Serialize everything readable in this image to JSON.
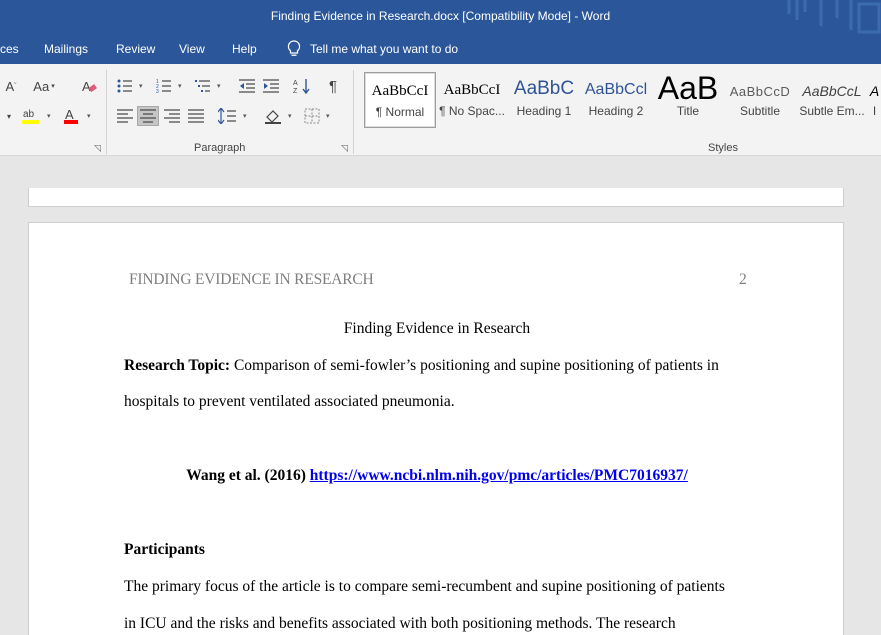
{
  "window": {
    "title": "Finding Evidence in Research.docx [Compatibility Mode]  -  Word"
  },
  "menu": {
    "items": [
      "ces",
      "Mailings",
      "Review",
      "View",
      "Help"
    ],
    "tell_me": "Tell me what you want to do"
  },
  "ribbon": {
    "font_size_label": "Aa",
    "paragraph_label": "Paragraph",
    "styles_label": "Styles",
    "styles": [
      {
        "sample": "AaBbCcI",
        "name": "¶ Normal",
        "selected": true
      },
      {
        "sample": "AaBbCcI",
        "name": "¶ No Spac..."
      },
      {
        "sample": "AaBbC",
        "name": "Heading 1"
      },
      {
        "sample": "AaBbCcl",
        "name": "Heading 2"
      },
      {
        "sample": "AaB",
        "name": "Title"
      },
      {
        "sample": "AaBbCcD",
        "name": "Subtitle"
      },
      {
        "sample": "AaBbCcL",
        "name": "Subtle Em..."
      },
      {
        "sample": "A",
        "name": "I"
      }
    ],
    "colors": {
      "highlight": "#ffff00",
      "font_color": "#ff0000"
    }
  },
  "document": {
    "running_head": "FINDING EVIDENCE IN RESEARCH",
    "page_number": "2",
    "title": "Finding Evidence in Research",
    "topic_label": "Research Topic:",
    "topic_line1": " Comparison of semi-fowler’s positioning and supine positioning of patients in",
    "topic_line2": "hospitals to prevent ventilated associated pneumonia.",
    "citation": "Wang et al. (2016) ",
    "citation_url": "https://www.ncbi.nlm.nih.gov/pmc/articles/PMC7016937/",
    "section_heading": "Participants",
    "para_line1": "The primary focus of the article is to compare semi-recumbent and supine positioning of patients",
    "para_line2": "in ICU and the risks and benefits associated with both positioning methods. The research"
  },
  "theme": {
    "titlebar": "#2b579a",
    "ribbon": "#f3f3f3",
    "canvas": "#e6e6e6"
  }
}
